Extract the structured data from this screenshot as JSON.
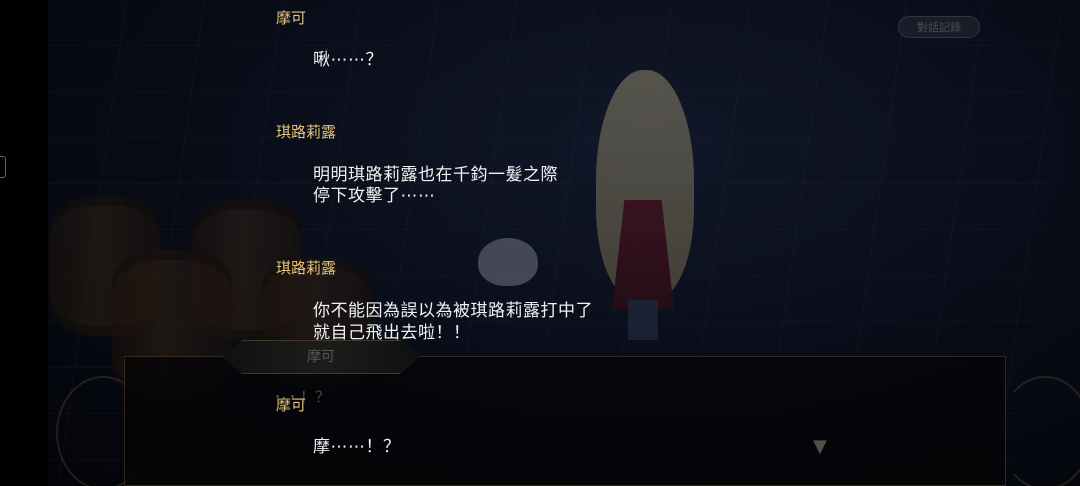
{
  "scene": {
    "log_button_label": "對話記錄"
  },
  "dialogue_box": {
    "speaker": "摩可",
    "text": "・・！？"
  },
  "log": [
    {
      "speaker": "摩可",
      "lines": [
        "啾⋯⋯？"
      ]
    },
    {
      "speaker": "琪路莉露",
      "lines": [
        "明明琪路莉露也在千鈞一髮之際",
        "停下攻擊了⋯⋯"
      ]
    },
    {
      "speaker": "琪路莉露",
      "lines": [
        "你不能因為誤以為被琪路莉露打中了",
        "就自己飛出去啦！！"
      ]
    },
    {
      "speaker": "摩可",
      "lines": [
        "摩⋯⋯！？"
      ]
    }
  ]
}
